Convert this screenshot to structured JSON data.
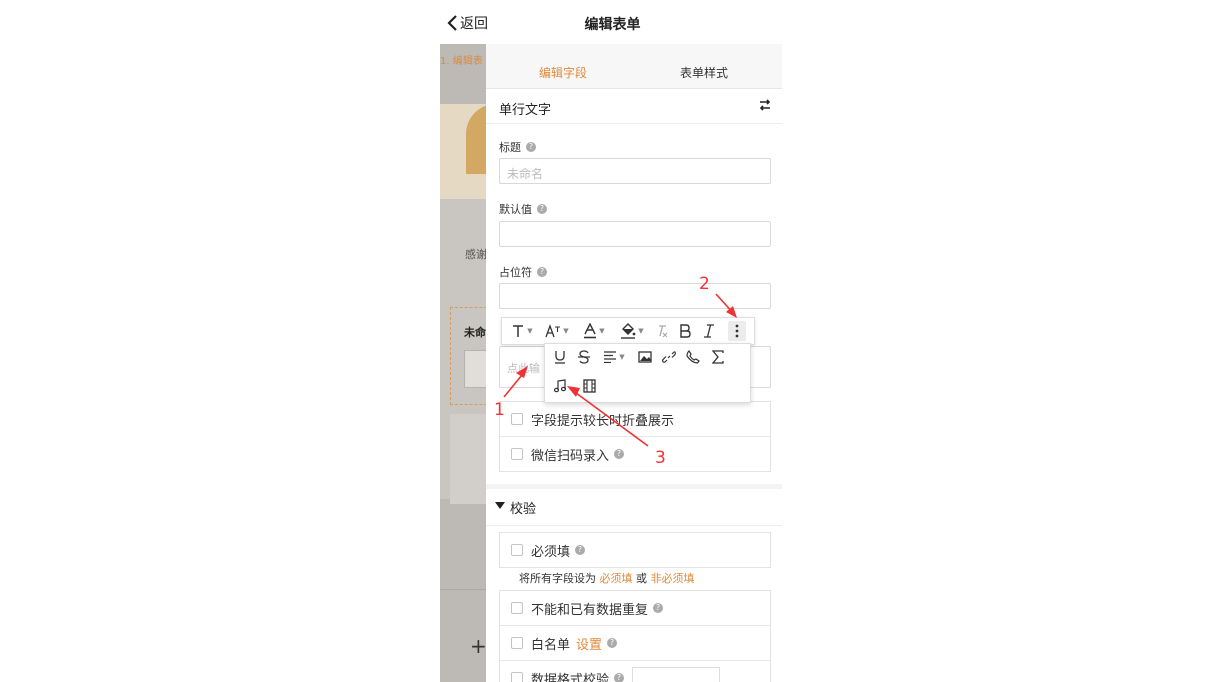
{
  "nav": {
    "back_label": "返回",
    "title": "编辑表单"
  },
  "background": {
    "tab_label": "1. 编辑表",
    "thanks_text": "感谢",
    "field_title": "未命",
    "add_symbol": "+"
  },
  "panel": {
    "tabs": [
      {
        "label": "编辑字段",
        "active": true
      },
      {
        "label": "表单样式",
        "active": false
      }
    ],
    "field_type": "单行文字",
    "title_label": "标题",
    "title_placeholder": "未命名",
    "default_label": "默认值",
    "placeholder_label": "占位符",
    "hint_placeholder": "点此输",
    "display_options": [
      {
        "label": "字段提示较长时折叠展示",
        "help": false
      },
      {
        "label": "微信扫码录入",
        "help": true
      }
    ],
    "validation_section": "校验",
    "required_label": "必须填",
    "bulk_prefix": "将所有字段设为",
    "bulk_required": "必须填",
    "bulk_or": "或",
    "bulk_optional": "非必须填",
    "validation_options": [
      {
        "label": "不能和已有数据重复",
        "link": "",
        "help": true
      },
      {
        "label": "白名单",
        "link": "设置",
        "help": true
      },
      {
        "label": "数据格式校验",
        "link": "",
        "help": true
      }
    ]
  },
  "toolbar": {
    "row1": [
      "text-style-icon",
      "font-size-icon",
      "font-color-icon",
      "bg-color-icon",
      "clear-format-icon",
      "bold-icon",
      "italic-icon",
      "more-icon"
    ],
    "row2": [
      "underline-icon",
      "strikethrough-icon",
      "align-icon",
      "image-icon",
      "link-icon",
      "phone-icon",
      "formula-icon"
    ],
    "row3": [
      "audio-icon",
      "video-icon"
    ]
  },
  "annotations": [
    "1",
    "2",
    "3"
  ],
  "colors": {
    "accent": "#e08a3c",
    "annotation": "#f03232"
  }
}
